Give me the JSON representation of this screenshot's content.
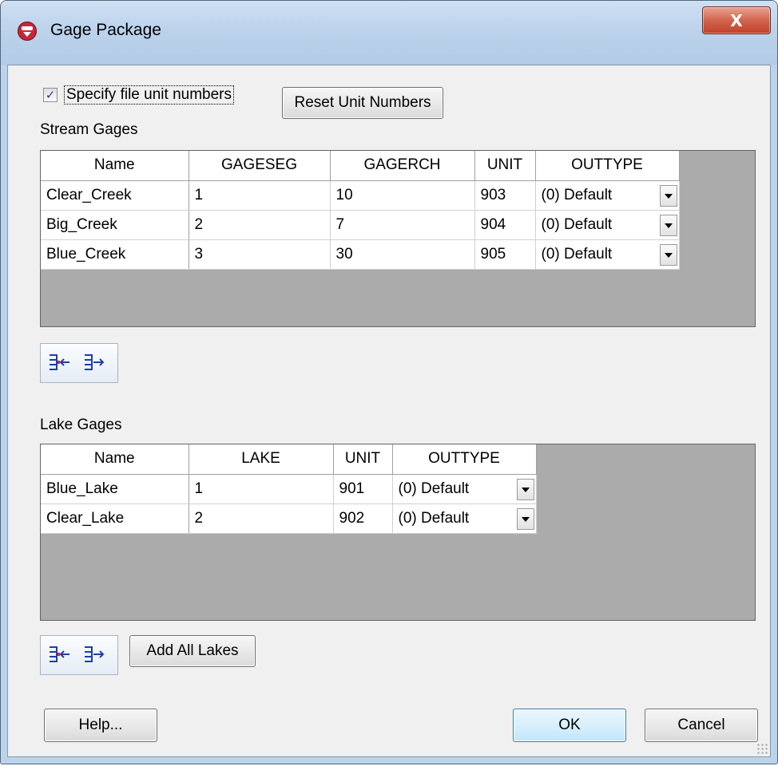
{
  "window": {
    "title": "Gage Package",
    "close_glyph": "X"
  },
  "options": {
    "specify_units_label": "Specify file unit numbers",
    "specify_units_checked": true,
    "check_glyph": "✓"
  },
  "buttons": {
    "reset_units": "Reset Unit Numbers",
    "add_all_lakes": "Add All Lakes",
    "help": "Help...",
    "ok": "OK",
    "cancel": "Cancel"
  },
  "stream_gages": {
    "label": "Stream Gages",
    "columns": [
      "Name",
      "GAGESEG",
      "GAGERCH",
      "UNIT",
      "OUTTYPE"
    ],
    "rows": [
      {
        "name": "Clear_Creek",
        "gageseg": "1",
        "gagerch": "10",
        "unit": "903",
        "outtype": "(0) Default"
      },
      {
        "name": "Big_Creek",
        "gageseg": "2",
        "gagerch": "7",
        "unit": "904",
        "outtype": "(0) Default"
      },
      {
        "name": "Blue_Creek",
        "gageseg": "3",
        "gagerch": "30",
        "unit": "905",
        "outtype": "(0) Default"
      }
    ]
  },
  "lake_gages": {
    "label": "Lake Gages",
    "columns": [
      "Name",
      "LAKE",
      "UNIT",
      "OUTTYPE"
    ],
    "rows": [
      {
        "name": "Blue_Lake",
        "lake": "1",
        "unit": "901",
        "outtype": "(0) Default"
      },
      {
        "name": "Clear_Lake",
        "lake": "2",
        "unit": "902",
        "outtype": "(0) Default"
      }
    ]
  },
  "icons": {
    "app": "gms-app-icon",
    "insert_row": "insert-row-icon",
    "delete_row": "delete-row-icon",
    "dropdown": "dropdown-arrow-icon"
  },
  "colors": {
    "grid_background": "#ababab",
    "window_frame": "#bcd3ec",
    "client": "#f0f0f0"
  }
}
